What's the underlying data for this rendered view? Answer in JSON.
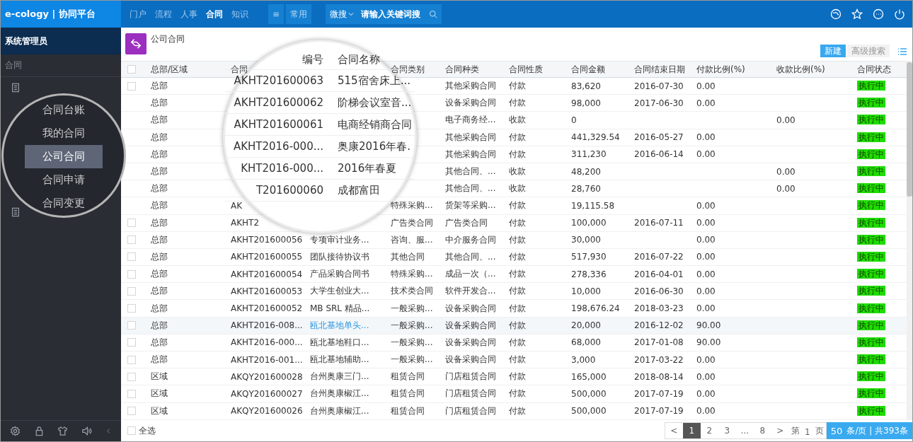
{
  "header": {
    "logo": "e-cology | 协同平台",
    "nav": [
      {
        "label": "门户",
        "selected": false
      },
      {
        "label": "流程",
        "selected": false
      },
      {
        "label": "人事",
        "selected": false
      },
      {
        "label": "合同",
        "selected": true
      },
      {
        "label": "知识",
        "selected": false
      }
    ],
    "menu_glyph": "≡",
    "quick": "常用",
    "search": {
      "scope": "微搜",
      "placeholder": "请输入关键词搜"
    }
  },
  "sidebar": {
    "user": "系统管理员",
    "section": "合同"
  },
  "sidebar_magnifier": {
    "items": [
      {
        "label": "合同台账",
        "selected": false
      },
      {
        "label": "我的合同",
        "selected": false
      },
      {
        "label": "公司合同",
        "selected": true
      },
      {
        "label": "合同申请",
        "selected": false
      },
      {
        "label": "合同变更",
        "selected": false
      }
    ]
  },
  "page": {
    "title": "公司合同",
    "buttons": [
      {
        "label": "新建",
        "kind": "primary"
      },
      {
        "label": "高级搜索",
        "kind": "plain"
      }
    ]
  },
  "table": {
    "header_checked": false,
    "columns": [
      "总部/区域",
      "合同",
      null,
      "合同类别",
      "合同种类",
      "合同性质",
      "合同金额",
      "合同结束日期",
      "付款比例(%)",
      "收款比例(%)",
      "合同状态"
    ],
    "rows": [
      {
        "checked": false,
        "highlighted": false,
        "region": "总部",
        "type": "其他采购合同",
        "nature": "付款",
        "amount": "83,620",
        "end_date": "2016-07-30",
        "pay_ratio": "0.00",
        "status": "执行中"
      },
      {
        "highlighted": false,
        "region": "总部",
        "type": "设备采购合同",
        "nature": "付款",
        "amount": "98,000",
        "end_date": "2017-06-30",
        "pay_ratio": "0.00",
        "status": "执行中"
      },
      {
        "highlighted": false,
        "region": "总部",
        "type": "电子商务经...",
        "nature": "收款",
        "amount": "0",
        "receive_ratio": "0.00",
        "status": "执行中"
      },
      {
        "highlighted": false,
        "region": "总部",
        "type": "其他采购合同",
        "nature": "付款",
        "amount": "441,329.54",
        "end_date": "2016-05-27",
        "pay_ratio": "0.00",
        "status": "执行中"
      },
      {
        "highlighted": false,
        "region": "总部",
        "type": "其他采购合同",
        "nature": "付款",
        "amount": "311,230",
        "end_date": "2016-06-14",
        "pay_ratio": "0.00",
        "status": "执行中"
      },
      {
        "highlighted": false,
        "region": "总部",
        "type": "其他合同、...",
        "nature": "收款",
        "amount": "48,200",
        "receive_ratio": "0.00",
        "status": "执行中"
      },
      {
        "highlighted": false,
        "region": "总部",
        "type": "其他合同、...",
        "nature": "收款",
        "amount": "28,760",
        "receive_ratio": "0.00",
        "status": "执行中"
      },
      {
        "highlighted": false,
        "region": "总部",
        "code": "AK",
        "category": "特殊采购...",
        "type": "货架等采购...",
        "nature": "付款",
        "amount": "19,115.58",
        "pay_ratio": "0.00",
        "status": "执行中"
      },
      {
        "checked": false,
        "highlighted": false,
        "region": "总部",
        "code": "AKHT2",
        "category": "广告类合同",
        "type": "广告类合同",
        "nature": "付款",
        "amount": "100,000",
        "end_date": "2016-07-11",
        "pay_ratio": "0.00",
        "status": "执行中"
      },
      {
        "checked": false,
        "highlighted": false,
        "region": "总部",
        "code": "AKHT201600056",
        "name": "专项审计业务...",
        "category": "咨询、服...",
        "type": "中介服务合同",
        "nature": "付款",
        "amount": "30,000",
        "pay_ratio": "0.00",
        "status": "执行中"
      },
      {
        "checked": false,
        "highlighted": false,
        "region": "总部",
        "code": "AKHT201600055",
        "name": "团队接待协议书",
        "category": "其他合同",
        "type": "其他合同、...",
        "nature": "付款",
        "amount": "517,930",
        "end_date": "2016-07-22",
        "pay_ratio": "0.00",
        "status": "执行中"
      },
      {
        "checked": false,
        "highlighted": false,
        "region": "总部",
        "code": "AKHT201600054",
        "name": "产品采购合同书",
        "category": "特殊采购...",
        "type": "成品一次（...",
        "nature": "付款",
        "amount": "278,336",
        "end_date": "2016-04-01",
        "pay_ratio": "0.00",
        "status": "执行中"
      },
      {
        "checked": false,
        "highlighted": false,
        "region": "总部",
        "code": "AKHT201600053",
        "name": "大学生创业大...",
        "category": "技术类合同",
        "type": "软件开发合...",
        "nature": "付款",
        "amount": "10,000",
        "end_date": "2016-06-30",
        "pay_ratio": "0.00",
        "status": "执行中"
      },
      {
        "checked": false,
        "highlighted": false,
        "region": "总部",
        "code": "AKHT201600052",
        "name": "MB SRL 精品...",
        "category": "一般采购...",
        "type": "设备采购合同",
        "nature": "付款",
        "amount": "198,676.24",
        "end_date": "2018-03-23",
        "pay_ratio": "0.00",
        "status": "执行中"
      },
      {
        "checked": false,
        "highlighted": true,
        "region": "总部",
        "code": "AKHT2016-008...",
        "name": "瓯北基地单头...",
        "name_link": true,
        "category": "一般采购...",
        "type": "设备采购合同",
        "nature": "付款",
        "amount": "20,000",
        "end_date": "2016-12-02",
        "pay_ratio": "90.00",
        "status": "执行中"
      },
      {
        "checked": false,
        "highlighted": false,
        "region": "总部",
        "code": "AKHT2016-000...",
        "name": "瓯北基地鞋口...",
        "category": "一般采购...",
        "type": "设备采购合同",
        "nature": "付款",
        "amount": "68,000",
        "end_date": "2017-01-08",
        "pay_ratio": "90.00",
        "status": "执行中"
      },
      {
        "checked": false,
        "highlighted": false,
        "region": "总部",
        "code": "AKHT2016-001...",
        "name": "瓯北基地辅助...",
        "category": "一般采购...",
        "type": "设备采购合同",
        "nature": "付款",
        "amount": "3,000",
        "end_date": "2017-03-22",
        "pay_ratio": "0.00",
        "status": "执行中"
      },
      {
        "checked": false,
        "highlighted": false,
        "region": "区域",
        "code": "AKQY201600028",
        "name": "台州奥康三门...",
        "category": "租赁合同",
        "type": "门店租赁合同",
        "nature": "付款",
        "amount": "165,000",
        "end_date": "2018-08-14",
        "pay_ratio": "0.00",
        "status": "执行中"
      },
      {
        "checked": false,
        "highlighted": false,
        "region": "区域",
        "code": "AKQY201600027",
        "name": "台州奥康椒江...",
        "category": "租赁合同",
        "type": "门店租赁合同",
        "nature": "付款",
        "amount": "500,000",
        "end_date": "2017-07-19",
        "pay_ratio": "0.00",
        "status": "执行中"
      },
      {
        "checked": false,
        "highlighted": false,
        "region": "区域",
        "code": "AKQY201600026",
        "name": "台州奥康椒江...",
        "category": "租赁合同",
        "type": "门店租赁合同",
        "nature": "付款",
        "amount": "500,000",
        "end_date": "2017-07-19",
        "pay_ratio": "0.00",
        "status": "执行中"
      }
    ]
  },
  "table_magnifier": {
    "header": {
      "code": "编号",
      "name": "合同名称"
    },
    "rows": [
      {
        "code": "AKHT201600063",
        "name": "515宿舍床上..."
      },
      {
        "code": "AKHT201600062",
        "name": "阶梯会议室音..."
      },
      {
        "code": "AKHT201600061",
        "name": "电商经销商合同"
      },
      {
        "code": "AKHT2016-000...",
        "name": "奥康2016年春."
      },
      {
        "code": "KHT2016-000...",
        "name": "2016年春夏"
      },
      {
        "code": "T201600060",
        "name": "成都富田"
      }
    ]
  },
  "footer": {
    "select_all": {
      "label": "全选",
      "checked": false
    },
    "prev": "<",
    "pages": [
      {
        "label": "1",
        "selected": true
      },
      {
        "label": "2",
        "selected": false
      },
      {
        "label": "3",
        "selected": false
      },
      {
        "label": "...",
        "selected": false
      },
      {
        "label": "8",
        "selected": false
      }
    ],
    "next": ">",
    "goto_prefix": "第",
    "goto_value": "1",
    "goto_suffix": "页",
    "page_size": "50",
    "page_info": "条/页 | 共393条"
  }
}
